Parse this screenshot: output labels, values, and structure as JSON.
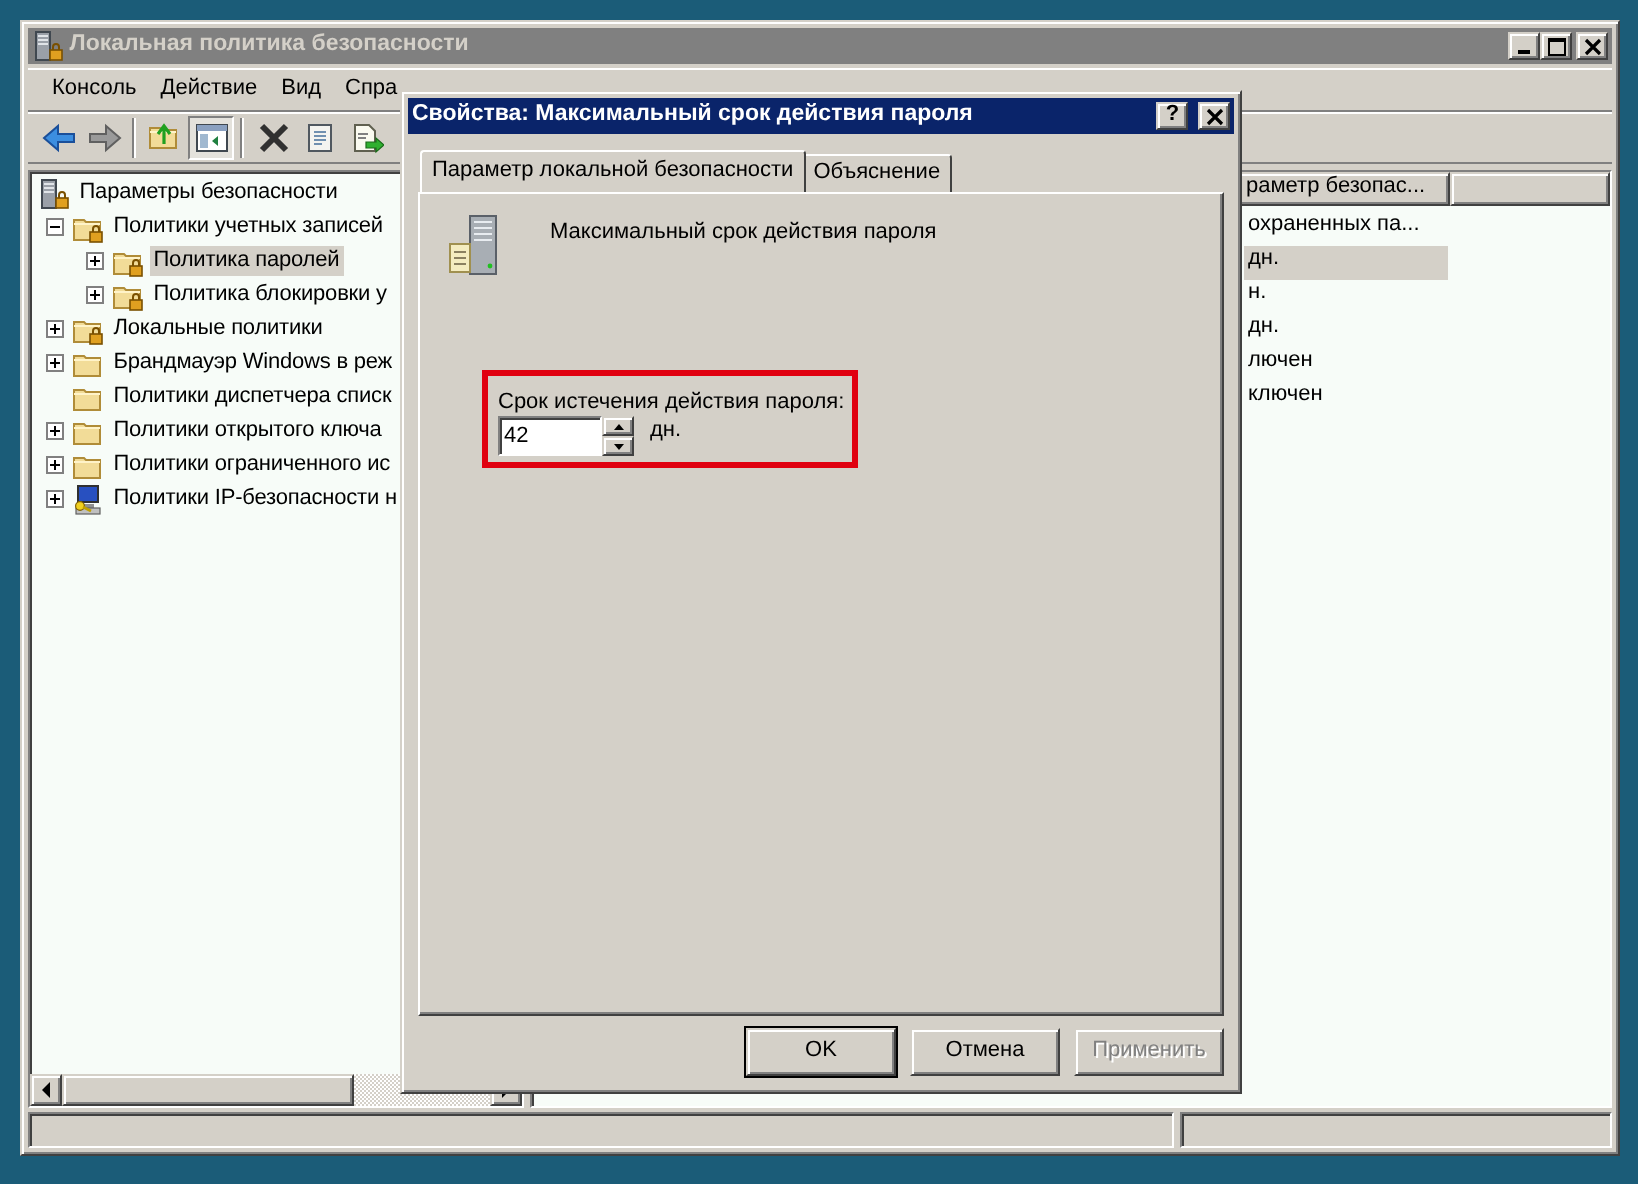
{
  "main_window": {
    "title": "Локальная политика безопасности",
    "active": false,
    "menu": [
      "Консоль",
      "Действие",
      "Вид",
      "Спра"
    ]
  },
  "toolbar": [
    {
      "kind": "back",
      "pressed": false
    },
    {
      "kind": "forward",
      "pressed": false
    },
    {
      "kind": "separator"
    },
    {
      "kind": "up",
      "pressed": false
    },
    {
      "kind": "pane",
      "pressed": true
    },
    {
      "kind": "separator"
    },
    {
      "kind": "delete",
      "pressed": false
    },
    {
      "kind": "properties",
      "pressed": false
    },
    {
      "kind": "export",
      "pressed": false
    }
  ],
  "tree": [
    {
      "label": "Параметры безопасности",
      "kind": "root",
      "selected": false,
      "children": [
        {
          "label": "Политики учетных записей",
          "kind": "lock-folder",
          "expanded": true,
          "selected": false,
          "children": [
            {
              "label": "Политика паролей",
              "kind": "lock-folder",
              "expanded": false,
              "selected": true
            },
            {
              "label": "Политика блокировки у",
              "kind": "lock-folder",
              "expanded": false,
              "selected": false
            }
          ]
        },
        {
          "label": "Локальные политики",
          "kind": "lock-folder",
          "expanded": false,
          "selected": false
        },
        {
          "label": "Брандмауэр Windows в реж",
          "kind": "folder",
          "expanded": false,
          "selected": false
        },
        {
          "label": "Политики диспетчера списк",
          "kind": "folder",
          "selected": false
        },
        {
          "label": "Политики открытого ключа",
          "kind": "folder",
          "expanded": false,
          "selected": false
        },
        {
          "label": "Политики ограниченного ис",
          "kind": "folder",
          "expanded": false,
          "selected": false
        },
        {
          "label": "Политики IP-безопасности н",
          "kind": "ip",
          "expanded": false,
          "selected": false
        }
      ]
    }
  ],
  "list": {
    "columns": [
      "раметр безопас..."
    ],
    "rows": [
      {
        "text": "охраненных па...",
        "selected": false
      },
      {
        "text": "дн.",
        "selected": true
      },
      {
        "text": "н.",
        "selected": false
      },
      {
        "text": "дн.",
        "selected": false
      },
      {
        "text": "лючен",
        "selected": false
      },
      {
        "text": "ключен",
        "selected": false
      }
    ]
  },
  "dialog": {
    "title": "Свойства: Максимальный срок действия пароля",
    "active": true,
    "help_button": "?",
    "tabs": [
      {
        "label": "Параметр локальной безопасности",
        "selected": true
      },
      {
        "label": "Объяснение",
        "selected": false
      }
    ],
    "policy_name": "Максимальный срок действия пароля",
    "field": {
      "label": "Срок истечения действия пароля:",
      "value": "42",
      "unit": "дн.",
      "highlighted": true
    },
    "buttons": [
      {
        "label": "OK",
        "default": true,
        "disabled": false
      },
      {
        "label": "Отмена",
        "default": false,
        "disabled": false
      },
      {
        "label": "Применить",
        "default": false,
        "disabled": true
      }
    ]
  }
}
